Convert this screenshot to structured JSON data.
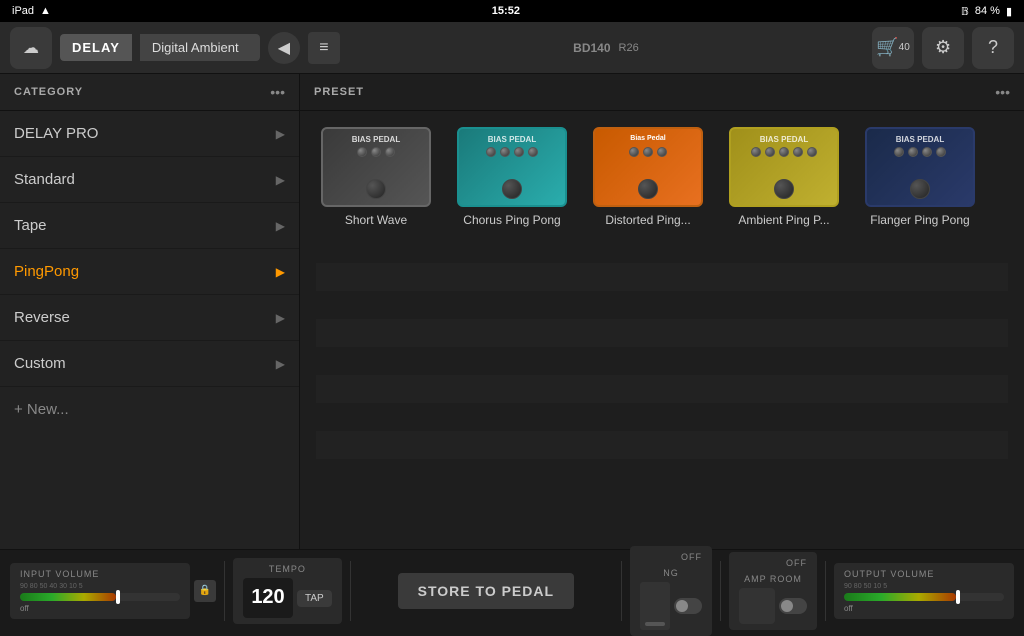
{
  "statusBar": {
    "device": "iPad",
    "wifi": "wifi-icon",
    "time": "15:52",
    "bluetooth": "84 %",
    "battery": "84"
  },
  "topBar": {
    "cloudLabel": "☁",
    "delayTag": "DELAY",
    "presetName": "Digital Ambient",
    "playIcon": "◀",
    "menuIcon": "≡",
    "bdLabel": "BD140",
    "rLabel": "R26",
    "cartLabel": "40",
    "cartIcon": "🛒",
    "gearIcon": "⚙",
    "helpIcon": "?"
  },
  "sidebar": {
    "header": "CATEGORY",
    "dotsLabel": "•••",
    "items": [
      {
        "label": "DELAY PRO",
        "active": false
      },
      {
        "label": "Standard",
        "active": false
      },
      {
        "label": "Tape",
        "active": false
      },
      {
        "label": "PingPong",
        "active": true
      },
      {
        "label": "Reverse",
        "active": false
      },
      {
        "label": "Custom",
        "active": false
      }
    ],
    "newItem": "+ New..."
  },
  "preset": {
    "header": "PRESET",
    "dotsLabel": "•••",
    "items": [
      {
        "name": "Short Wave",
        "style": "shortwave",
        "brand": "BIAS PEDAL"
      },
      {
        "name": "Chorus Ping Pong",
        "style": "chorus",
        "brand": "BIAS PEDAL"
      },
      {
        "name": "Distorted Ping...",
        "style": "distorted",
        "brand": "Bias Pedal"
      },
      {
        "name": "Ambient Ping P...",
        "style": "ambient",
        "brand": "BIAS PEDAL"
      },
      {
        "name": "Flanger Ping Pong",
        "style": "flanger",
        "brand": "BIAS PEDAL"
      }
    ]
  },
  "bottomBar": {
    "inputVolumeLabel": "INPUT VOLUME",
    "tempoLabel": "TEMPO",
    "tempoValue": "120",
    "tapLabel": "TAP",
    "storeLabel": "STORE TO PEDAL",
    "ngLabel": "NG",
    "ampRoomLabel": "AMP ROOM",
    "outputVolumeLabel": "OUTPUT VOLUME",
    "lockLabel": "LOCK",
    "offLabel": "off"
  }
}
